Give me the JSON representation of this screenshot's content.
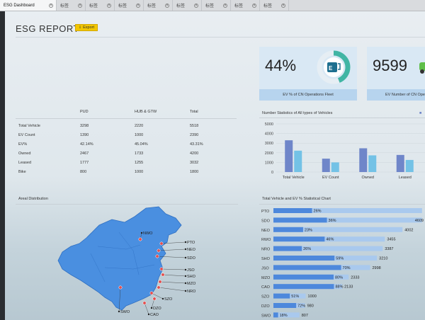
{
  "tabs": [
    {
      "label": "ESG Dashboard",
      "active": true
    },
    {
      "label": "标签"
    },
    {
      "label": "标签"
    },
    {
      "label": "标签"
    },
    {
      "label": "标签"
    },
    {
      "label": "标签"
    },
    {
      "label": "标签"
    },
    {
      "label": "标签"
    },
    {
      "label": "标签"
    }
  ],
  "report": {
    "title": "ESG REPORT",
    "export_label": "Export"
  },
  "kpis": [
    {
      "value": "44%",
      "caption": "EV % of CN Operations Fleet",
      "ring_fraction": 0.44,
      "icon": "ev-charging-icon"
    },
    {
      "value": "9599",
      "caption": "EV Number of CN Operations Fleet",
      "icon": "car-icon"
    }
  ],
  "summary_table": {
    "columns": [
      "",
      "PUD",
      "HUB & GTW",
      "Total"
    ],
    "rows": [
      [
        "Total Vehicle",
        "3298",
        "2220",
        "5518"
      ],
      [
        "EV Count",
        "1390",
        "1000",
        "2390"
      ],
      [
        "EV%",
        "42.14%",
        "45.04%",
        "43.31%"
      ],
      [
        "Owned",
        "2467",
        "1733",
        "4200"
      ],
      [
        "Leased",
        "1777",
        "1255",
        "3032"
      ],
      [
        "Bike",
        "800",
        "1000",
        "1800"
      ]
    ]
  },
  "sections": {
    "vehicle_stats": "Number Statistics of All types of Vehicles",
    "areal": "Areal Distribution",
    "ev_stats": "Total Vehicle and EV % Statistical Chart"
  },
  "chart_data": [
    {
      "type": "bar",
      "title": "Number Statistics of All types of Vehicles",
      "categories": [
        "Total Vehicle",
        "EV Count",
        "Owned",
        "Leased"
      ],
      "series": [
        {
          "values": [
            3298,
            1390,
            2467,
            1777
          ],
          "color": "#6f86c9"
        },
        {
          "values": [
            2220,
            1000,
            1733,
            1255
          ],
          "color": "#73c2e6"
        }
      ],
      "y_ticks": [
        0,
        1000,
        2000,
        3000,
        4000,
        5000
      ],
      "ylim": [
        0,
        5000
      ],
      "grid": true
    },
    {
      "type": "bar",
      "orientation": "horizontal",
      "title": "Total Vehicle and EV % Statistical Chart",
      "categories": [
        "PTO",
        "SDO",
        "NEO",
        "RWO",
        "NRO",
        "SHO",
        "JSO",
        "MZO",
        "CAO",
        "SZO",
        "DZO",
        "SWO"
      ],
      "values": [
        4608,
        4609,
        4002,
        3455,
        3387,
        3210,
        2998,
        2333,
        2133,
        1000,
        980,
        807
      ],
      "ev_pct_labels": [
        "26%",
        "36%",
        "23%",
        "46%",
        "26%",
        "59%",
        "70%",
        "80%",
        "88%",
        "51%",
        "72%",
        "18%"
      ],
      "value_labels": [
        "",
        "4609",
        "4002",
        "3455",
        "3387",
        "3210",
        "2998",
        "2333",
        "2133",
        "1000",
        "980",
        "807"
      ],
      "xlim": [
        0,
        4700
      ]
    }
  ],
  "map": {
    "labels": [
      "NWO",
      "PTO",
      "NEO",
      "SDO",
      "JSO",
      "SHO",
      "MZO",
      "NRO",
      "SZO",
      "DZO",
      "SWO",
      "CAO"
    ]
  }
}
